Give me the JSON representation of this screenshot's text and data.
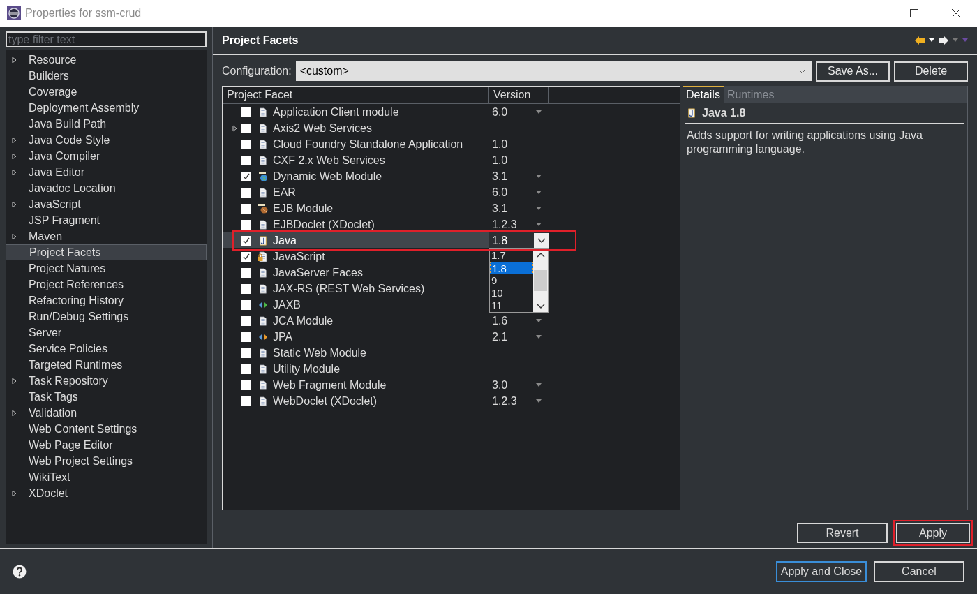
{
  "window": {
    "title": "Properties for ssm-crud"
  },
  "filter": {
    "placeholder": "type filter text"
  },
  "sidebar": {
    "items": [
      {
        "label": "Resource",
        "expandable": true,
        "selected": false
      },
      {
        "label": "Builders",
        "expandable": false,
        "selected": false
      },
      {
        "label": "Coverage",
        "expandable": false,
        "selected": false
      },
      {
        "label": "Deployment Assembly",
        "expandable": false,
        "selected": false
      },
      {
        "label": "Java Build Path",
        "expandable": false,
        "selected": false
      },
      {
        "label": "Java Code Style",
        "expandable": true,
        "selected": false
      },
      {
        "label": "Java Compiler",
        "expandable": true,
        "selected": false
      },
      {
        "label": "Java Editor",
        "expandable": true,
        "selected": false
      },
      {
        "label": "Javadoc Location",
        "expandable": false,
        "selected": false
      },
      {
        "label": "JavaScript",
        "expandable": true,
        "selected": false
      },
      {
        "label": "JSP Fragment",
        "expandable": false,
        "selected": false
      },
      {
        "label": "Maven",
        "expandable": true,
        "selected": false
      },
      {
        "label": "Project Facets",
        "expandable": false,
        "selected": true
      },
      {
        "label": "Project Natures",
        "expandable": false,
        "selected": false
      },
      {
        "label": "Project References",
        "expandable": false,
        "selected": false
      },
      {
        "label": "Refactoring History",
        "expandable": false,
        "selected": false
      },
      {
        "label": "Run/Debug Settings",
        "expandable": false,
        "selected": false
      },
      {
        "label": "Server",
        "expandable": false,
        "selected": false
      },
      {
        "label": "Service Policies",
        "expandable": false,
        "selected": false
      },
      {
        "label": "Targeted Runtimes",
        "expandable": false,
        "selected": false
      },
      {
        "label": "Task Repository",
        "expandable": true,
        "selected": false
      },
      {
        "label": "Task Tags",
        "expandable": false,
        "selected": false
      },
      {
        "label": "Validation",
        "expandable": true,
        "selected": false
      },
      {
        "label": "Web Content Settings",
        "expandable": false,
        "selected": false
      },
      {
        "label": "Web Page Editor",
        "expandable": false,
        "selected": false
      },
      {
        "label": "Web Project Settings",
        "expandable": false,
        "selected": false
      },
      {
        "label": "WikiText",
        "expandable": false,
        "selected": false
      },
      {
        "label": "XDoclet",
        "expandable": true,
        "selected": false
      }
    ]
  },
  "page": {
    "title": "Project Facets"
  },
  "configuration": {
    "label": "Configuration:",
    "value": "<custom>",
    "buttons": [
      "Save As...",
      "Delete"
    ]
  },
  "table": {
    "columns": [
      "Project Facet",
      "Version"
    ],
    "rows": [
      {
        "name": "Application Client module",
        "kind": "document",
        "checked": false,
        "expandable": false,
        "selected": false,
        "highlighted": false,
        "version": "6.0",
        "has_versions": true
      },
      {
        "name": "Axis2 Web Services",
        "kind": "document",
        "checked": false,
        "expandable": true,
        "selected": false,
        "highlighted": false,
        "has_versions": false
      },
      {
        "name": "Cloud Foundry Standalone Application",
        "kind": "document",
        "checked": false,
        "expandable": false,
        "selected": false,
        "highlighted": false,
        "version": "1.0",
        "has_versions": false
      },
      {
        "name": "CXF 2.x Web Services",
        "kind": "document",
        "checked": false,
        "expandable": false,
        "selected": false,
        "highlighted": false,
        "version": "1.0",
        "has_versions": false
      },
      {
        "name": "Dynamic Web Module",
        "kind": "web",
        "checked": true,
        "expandable": false,
        "selected": false,
        "highlighted": false,
        "version": "3.1",
        "has_versions": true
      },
      {
        "name": "EAR",
        "kind": "document",
        "checked": false,
        "expandable": false,
        "selected": false,
        "highlighted": false,
        "version": "6.0",
        "has_versions": true
      },
      {
        "name": "EJB Module",
        "kind": "bean",
        "checked": false,
        "expandable": false,
        "selected": false,
        "highlighted": false,
        "version": "3.1",
        "has_versions": true
      },
      {
        "name": "EJBDoclet (XDoclet)",
        "kind": "document",
        "checked": false,
        "expandable": false,
        "selected": false,
        "highlighted": false,
        "version": "1.2.3",
        "has_versions": true
      },
      {
        "name": "Java",
        "kind": "java",
        "checked": true,
        "expandable": false,
        "selected": true,
        "highlighted": true,
        "version": "1.8",
        "has_versions": true,
        "dropdown": {
          "options": [
            {
              "label": "1.7",
              "selected": false
            },
            {
              "label": "1.8",
              "selected": true
            },
            {
              "label": "9",
              "selected": false
            },
            {
              "label": "10",
              "selected": false
            },
            {
              "label": "11",
              "selected": false
            }
          ]
        }
      },
      {
        "name": "JavaScript",
        "kind": "locked",
        "checked": true,
        "expandable": false,
        "selected": false,
        "highlighted": false
      },
      {
        "name": "JavaServer Faces",
        "kind": "document",
        "checked": false,
        "expandable": false,
        "selected": false,
        "highlighted": false
      },
      {
        "name": "JAX-RS (REST Web Services)",
        "kind": "document",
        "checked": false,
        "expandable": false,
        "selected": false,
        "highlighted": false
      },
      {
        "name": "JAXB",
        "kind": "binding",
        "checked": false,
        "expandable": false,
        "selected": false,
        "highlighted": false
      },
      {
        "name": "JCA Module",
        "kind": "document",
        "checked": false,
        "expandable": false,
        "selected": false,
        "highlighted": false,
        "version": "1.6",
        "has_versions": true
      },
      {
        "name": "JPA",
        "kind": "persistence",
        "checked": false,
        "expandable": false,
        "selected": false,
        "highlighted": false,
        "version": "2.1",
        "has_versions": true
      },
      {
        "name": "Static Web Module",
        "kind": "document",
        "checked": false,
        "expandable": false,
        "selected": false,
        "highlighted": false,
        "has_versions": false
      },
      {
        "name": "Utility Module",
        "kind": "document",
        "checked": false,
        "expandable": false,
        "selected": false,
        "highlighted": false,
        "has_versions": false
      },
      {
        "name": "Web Fragment Module",
        "kind": "document",
        "checked": false,
        "expandable": false,
        "selected": false,
        "highlighted": false,
        "version": "3.0",
        "has_versions": true
      },
      {
        "name": "WebDoclet (XDoclet)",
        "kind": "document",
        "checked": false,
        "expandable": false,
        "selected": false,
        "highlighted": false,
        "version": "1.2.3",
        "has_versions": true
      }
    ]
  },
  "details": {
    "tabs": [
      {
        "label": "Details",
        "selected": true
      },
      {
        "label": "Runtimes",
        "selected": false
      }
    ],
    "title": "Java 1.8",
    "description": "Adds support for writing applications using Java programming language."
  },
  "page_buttons": [
    {
      "label": "Revert",
      "highlighted": false
    },
    {
      "label": "Apply",
      "highlighted": true
    }
  ],
  "dialog_buttons": [
    {
      "label": "Apply and Close",
      "default": true
    },
    {
      "label": "Cancel",
      "default": false
    }
  ]
}
